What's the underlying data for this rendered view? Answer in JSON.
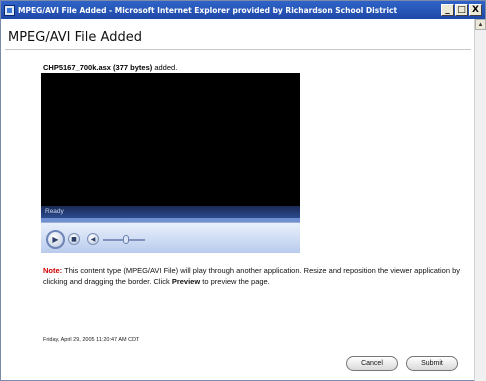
{
  "window": {
    "title": "MPEG/AVI File Added - Microsoft Internet Explorer provided by Richardson School District",
    "minimize_glyph": "_",
    "maximize_glyph": "□",
    "close_glyph": "X"
  },
  "page": {
    "title": "MPEG/AVI File Added",
    "added_file": "CHP5167_700k.asx (377 bytes)",
    "added_suffix": " added."
  },
  "player": {
    "status": "Ready",
    "icons": {
      "play": "play-icon",
      "stop": "stop-icon",
      "volume": "volume-icon"
    },
    "volume_level": 0.55
  },
  "note": {
    "label": "Note:",
    "text_before": " This content type (MPEG/AVI File) will play through another application. Resize and reposition the viewer application by clicking and dragging the border. Click ",
    "preview_word": "Preview",
    "text_after": " to preview the page."
  },
  "timestamp": "Friday, April 29, 2005 11:20:47 AM CDT",
  "buttons": {
    "cancel": "Cancel",
    "submit": "Submit"
  },
  "colors": {
    "titlebar": "#2f63c8",
    "note_label": "#cc0000",
    "video_bg": "#000000"
  }
}
